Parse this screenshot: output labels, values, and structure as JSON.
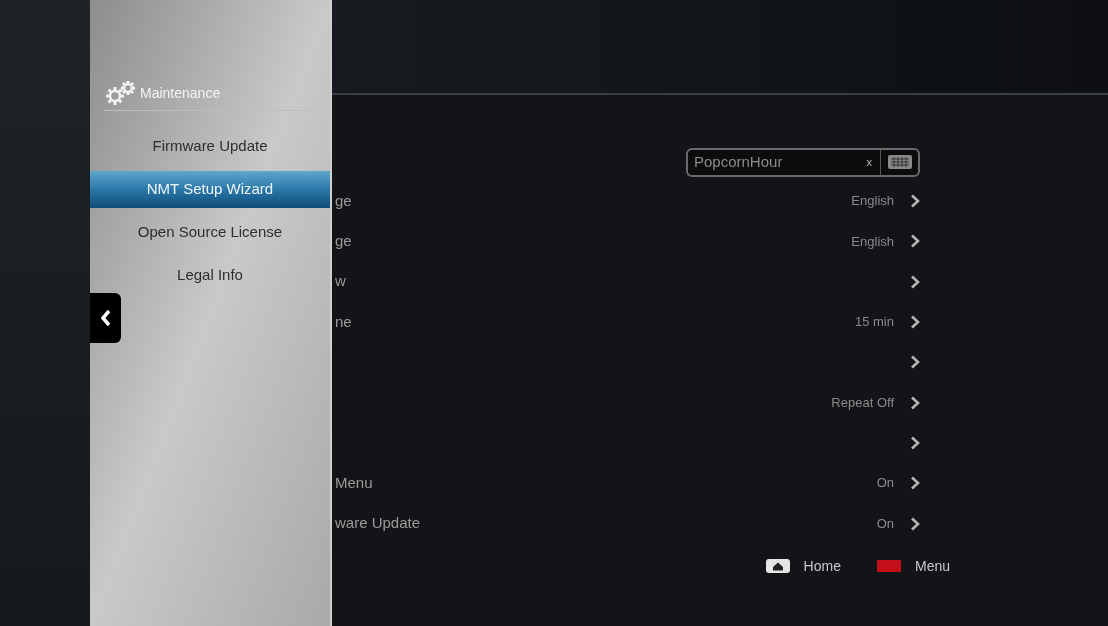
{
  "sidebar": {
    "title": "Maintenance",
    "items": [
      {
        "label": "Firmware Update",
        "selected": false
      },
      {
        "label": "NMT Setup Wizard",
        "selected": true
      },
      {
        "label": "Open Source License",
        "selected": false
      },
      {
        "label": "Legal Info",
        "selected": false
      }
    ]
  },
  "name_field": {
    "value": "PopcornHour",
    "clear": "x"
  },
  "settings": [
    {
      "kind": "option",
      "label": "ge",
      "value": "English"
    },
    {
      "kind": "option",
      "label": "ge",
      "value": "English"
    },
    {
      "kind": "link",
      "label": "w"
    },
    {
      "kind": "option",
      "label": "ne",
      "value": "15 min"
    },
    {
      "kind": "link"
    },
    {
      "kind": "option",
      "value": "Repeat Off"
    },
    {
      "kind": "link"
    },
    {
      "kind": "option",
      "label": "Menu",
      "value": "On"
    },
    {
      "kind": "option",
      "label": "ware Update",
      "value": "On"
    }
  ],
  "footer": [
    {
      "kind": "home",
      "label": "Home"
    },
    {
      "kind": "red",
      "label": "Menu"
    }
  ]
}
